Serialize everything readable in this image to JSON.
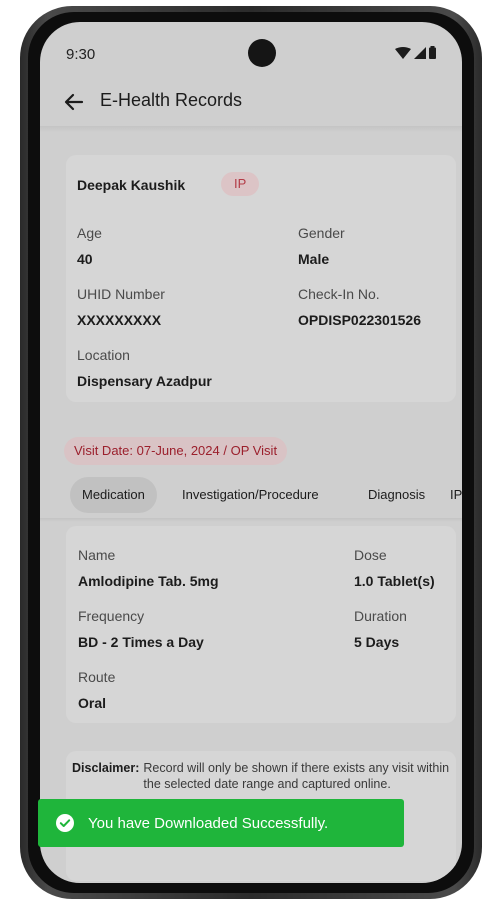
{
  "status_bar": {
    "time": "9:30"
  },
  "app_bar": {
    "title": "E-Health Records"
  },
  "patient": {
    "name": "Deepak Kaushik",
    "badge": "IP",
    "age_label": "Age",
    "age": "40",
    "gender_label": "Gender",
    "gender": "Male",
    "uhid_label": "UHID Number",
    "uhid": "XXXXXXXXX",
    "checkin_label": "Check-In No.",
    "checkin": "OPDISP022301526",
    "location_label": "Location",
    "location": "Dispensary Azadpur"
  },
  "visit": {
    "date_text": "Visit Date: 07-June, 2024 / OP Visit"
  },
  "tabs": [
    {
      "label": "Medication",
      "active": true
    },
    {
      "label": "Investigation/Procedure",
      "active": false
    },
    {
      "label": "Diagnosis",
      "active": false
    },
    {
      "label": "IPD",
      "active": false
    }
  ],
  "medication": {
    "name_label": "Name",
    "name": "Amlodipine Tab. 5mg",
    "dose_label": "Dose",
    "dose": "1.0 Tablet(s)",
    "frequency_label": "Frequency",
    "frequency": "BD - 2 Times a Day",
    "duration_label": "Duration",
    "duration": "5 Days",
    "route_label": "Route",
    "route": "Oral"
  },
  "disclaimer": {
    "label": "Disclaimer:",
    "text": "Record will only be shown if there exists any visit within the selected date range and captured online."
  },
  "toast": {
    "message": "You have Downloaded Successfully."
  },
  "colors": {
    "toast_bg": "#1fb53b",
    "badge_text": "#b33b46",
    "visit_text": "#9b1f2c"
  }
}
